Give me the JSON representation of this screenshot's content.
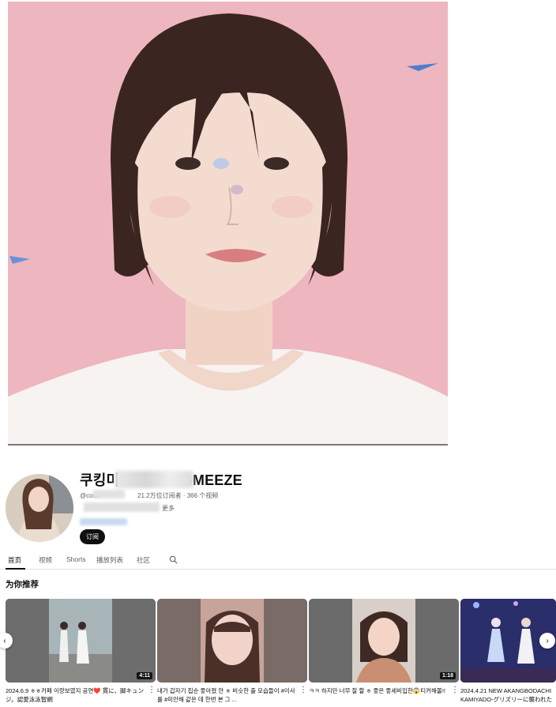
{
  "channel": {
    "name": "쿠킹미 COOKINGMEEZE",
    "handle": "@cooki",
    "stats": "21.2万位订阅者 · 366 个视频",
    "description": "更多",
    "subscribe_label": "订阅"
  },
  "tabs": [
    {
      "label": "首页",
      "active": true
    },
    {
      "label": "视频",
      "active": false
    },
    {
      "label": "Shorts",
      "active": false
    },
    {
      "label": "播放列表",
      "active": false
    },
    {
      "label": "社区",
      "active": false
    }
  ],
  "section_title": "为你推荐",
  "videos": [
    {
      "title": "2024.6.9 ㅎㅎ카페 이랑보였지 공연❤️ 貫に、脚キュンジ。認愛泳泳智網",
      "duration": "4:11"
    },
    {
      "title": "내가 갑자기 집순 좋아졌 안 ㅎ 비슷한 출 모습들이 #이사를 #미안해 같은 데 한번 본 그 ...",
      "duration": ""
    },
    {
      "title": "ㅋㅋ 하지만 너무 잘 할 ㅎ 좋은 좋세비입한😱티커해볼!!",
      "duration": "1:18"
    },
    {
      "title": "2024.4.21 NEW AKANGBODACHI KAMIYADO-グリズリーに襲われた",
      "duration": ""
    }
  ],
  "icons": {
    "search": "search-icon",
    "prev": "chevron-left-icon",
    "next": "chevron-right-icon",
    "more": "more-vert-icon"
  },
  "colors": {
    "banner_bg": "#eeb6bf",
    "subscribe_bg": "#0f0f0f"
  }
}
